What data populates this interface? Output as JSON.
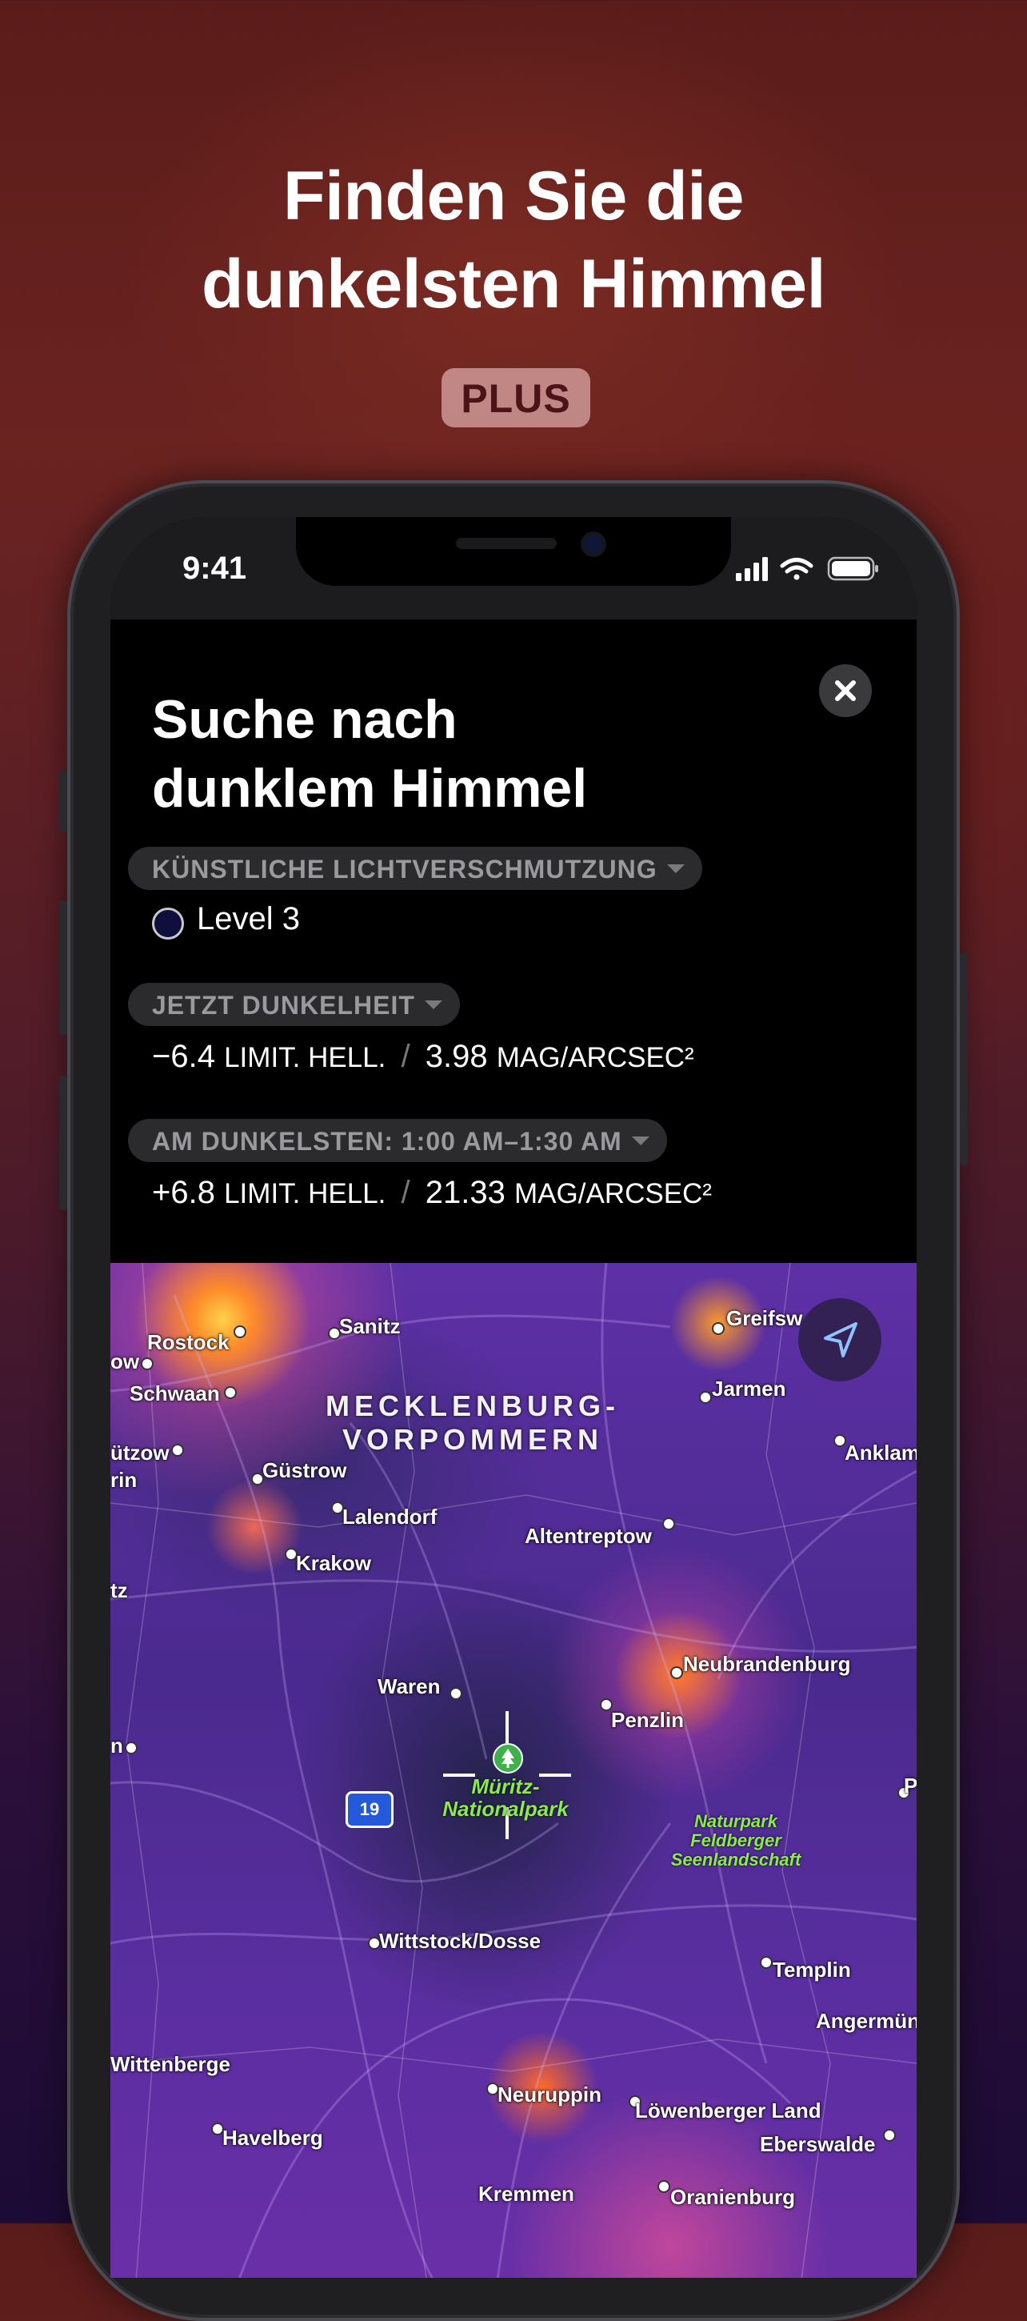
{
  "promo": {
    "title_line1": "Finden Sie die",
    "title_line2": "dunkelsten Himmel",
    "badge": "PLUS"
  },
  "status_bar": {
    "time": "9:41"
  },
  "sheet": {
    "title_line1": "Suche nach",
    "title_line2": "dunklem Himmel",
    "light_pollution": {
      "chip": "KÜNSTLICHE LICHTVERSCHMUTZUNG",
      "level": "Level 3"
    },
    "now": {
      "chip": "JETZT DUNKELHEIT",
      "limit_value": "−6.4",
      "limit_unit": "LIMIT. HELL.",
      "separator": "/",
      "sqm_value": "3.98",
      "sqm_unit": "MAG/ARCSEC²"
    },
    "darkest": {
      "chip": "AM DUNKELSTEN: 1:00 AM–1:30 AM",
      "limit_value": "+6.8",
      "limit_unit": "LIMIT. HELL.",
      "separator": "/",
      "sqm_value": "21.33",
      "sqm_unit": "MAG/ARCSEC²"
    }
  },
  "map": {
    "region_line1": "MECKLENBURG-",
    "region_line2": "VORPOMMERN",
    "park_line1": "Müritz-",
    "park_line2": "Nationalpark",
    "nature_park_line1": "Naturpark",
    "nature_park_line2": "Feldberger",
    "nature_park_line3": "Seenlandschaft",
    "route_number": "19",
    "cities": {
      "rostock": "Rostock",
      "sanitz": "Sanitz",
      "greifswald": "Greifsw",
      "ow": "ow",
      "schwaan": "Schwaan",
      "jarmen": "Jarmen",
      "butzow": "ützow",
      "rin": "rin",
      "gustrow": "Güstrow",
      "anklam": "Anklam",
      "lalendorf": "Lalendorf",
      "altentreptow": "Altentreptow",
      "krakow": "Krakow",
      "tz": "tz",
      "neubrandenburg": "Neubrandenburg",
      "waren": "Waren",
      "penzlin": "Penzlin",
      "n_edge": "n",
      "p_edge": "P",
      "wittstock": "Wittstock/Dosse",
      "templin": "Templin",
      "angermunde": "Angermün",
      "wittenberge": "Wittenberge",
      "neuruppin": "Neuruppin",
      "lowenberger": "Löwenberger Land",
      "havelberg": "Havelberg",
      "eberswalde": "Eberswalde",
      "kremmen": "Kremmen",
      "oranienburg": "Oranienburg"
    }
  },
  "colors": {
    "accent_map": "#5e30a6",
    "park_green": "#8bea4c",
    "background_top": "#5a1c1a",
    "background_bottom": "#1c0b35"
  },
  "icons": {
    "close": "close-icon",
    "caret": "chevron-down-icon",
    "locate": "location-arrow-icon",
    "signal": "cellular-signal-icon",
    "wifi": "wifi-icon",
    "battery": "battery-icon",
    "park": "tree-icon"
  }
}
